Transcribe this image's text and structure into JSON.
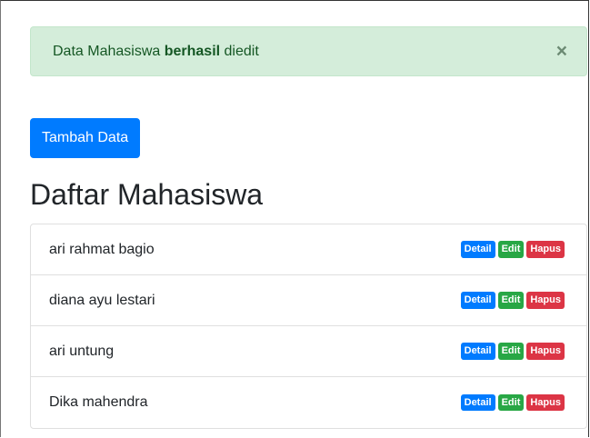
{
  "alert": {
    "prefix": "Data Mahasiswa ",
    "bold": "berhasil",
    "suffix": " diedit",
    "close": "×"
  },
  "toolbar": {
    "add_label": "Tambah Data"
  },
  "page": {
    "title": "Daftar Mahasiswa"
  },
  "mahasiswa": [
    {
      "name": "ari rahmat bagio",
      "detail": "Detail",
      "edit": "Edit",
      "delete": "Hapus"
    },
    {
      "name": "diana ayu lestari",
      "detail": "Detail",
      "edit": "Edit",
      "delete": "Hapus"
    },
    {
      "name": "ari untung",
      "detail": "Detail",
      "edit": "Edit",
      "delete": "Hapus"
    },
    {
      "name": "Dika mahendra",
      "detail": "Detail",
      "edit": "Edit",
      "delete": "Hapus"
    }
  ],
  "colors": {
    "primary": "#007bff",
    "success": "#28a745",
    "danger": "#dc3545",
    "alert_bg": "#d4edda"
  }
}
